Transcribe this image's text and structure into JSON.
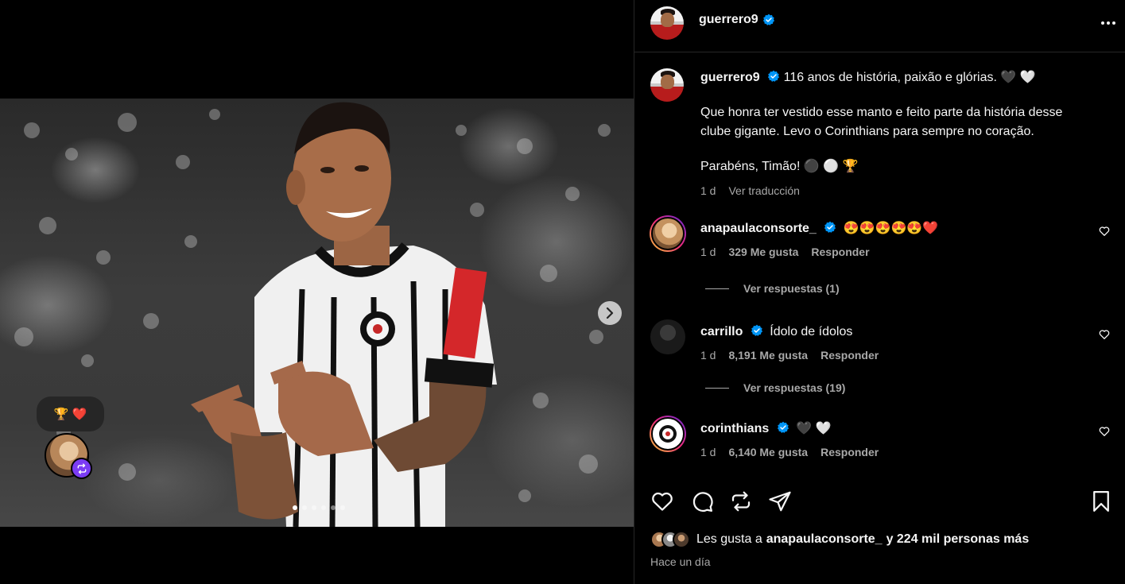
{
  "post": {
    "author": "guerrero9",
    "caption_line1": "116 anos de história, paixão e glórias. 🖤 🤍",
    "caption_line2": "Que honra ter vestido esse manto e feito parte da história desse clube gigante. Levo o Corinthians para sempre no coração.",
    "caption_line3": "Parabéns, Timão! ⚫ ⚪ 🏆",
    "caption_time": "1 d",
    "translate_label": "Ver traducción",
    "likes_prefix": "Les gusta a",
    "likes_user": "anapaulaconsorte_",
    "likes_suffix": "y 224 mil personas más",
    "time_ago": "Hace un día"
  },
  "note": {
    "emoji": "🏆 ❤️"
  },
  "comments": [
    {
      "user": "anapaulaconsorte_",
      "text": "😍😍😍😍😍❤️",
      "time": "1 d",
      "likes": "329 Me gusta",
      "reply_label": "Responder",
      "replies_label": "Ver respuestas (1)"
    },
    {
      "user": "carrillo",
      "text": "Ídolo de ídolos",
      "time": "1 d",
      "likes": "8,191 Me gusta",
      "reply_label": "Responder",
      "replies_label": "Ver respuestas (19)"
    },
    {
      "user": "corinthians",
      "text": "🖤 🤍",
      "time": "1 d",
      "likes": "6,140 Me gusta",
      "reply_label": "Responder"
    }
  ],
  "colors": {
    "verified": "#0095f6",
    "secondary_text": "#a8a8a8",
    "repost_badge": "#7b3cf4",
    "divider": "#262626"
  },
  "icons": [
    "verified-icon",
    "more-options-icon",
    "chevron-right-icon",
    "heart-icon",
    "comment-icon",
    "repost-icon",
    "share-icon",
    "bookmark-icon"
  ]
}
